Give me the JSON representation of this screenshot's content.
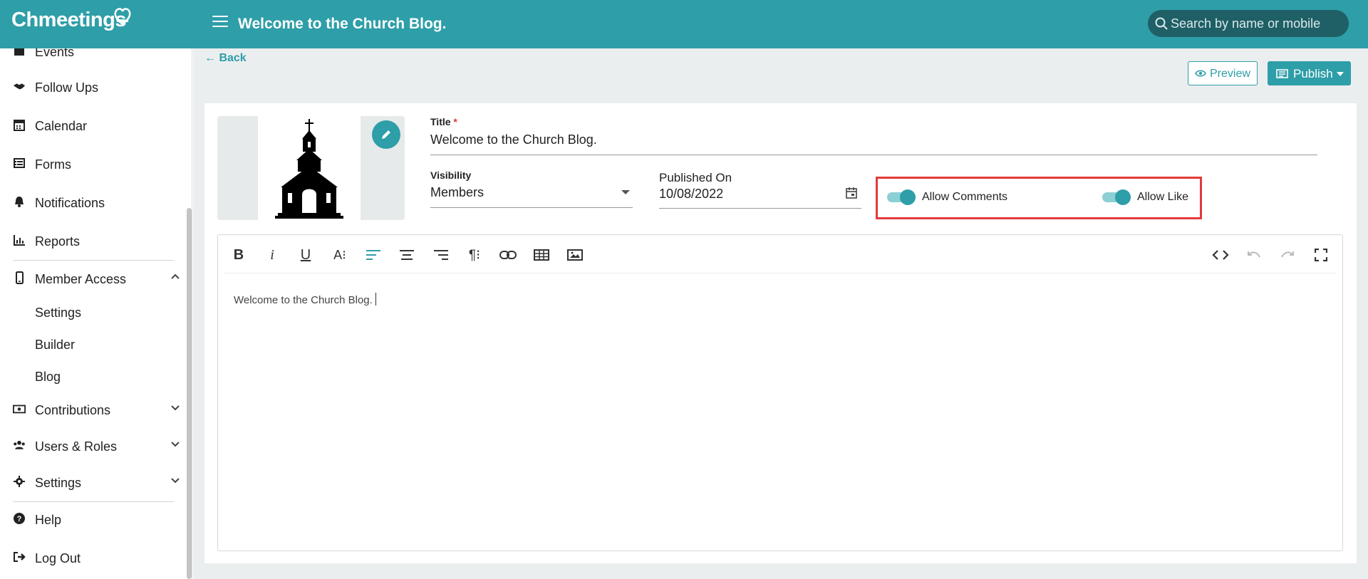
{
  "header": {
    "logo_text": "Chmeetings",
    "title": "Welcome to the Church Blog.",
    "search_placeholder": "Search by name or mobile"
  },
  "sidebar": {
    "items": [
      {
        "label": "Events",
        "icon": "calendar-event-icon"
      },
      {
        "label": "Follow Ups",
        "icon": "handshake-icon"
      },
      {
        "label": "Calendar",
        "icon": "calendar-icon"
      },
      {
        "label": "Forms",
        "icon": "form-icon"
      },
      {
        "label": "Notifications",
        "icon": "bell-icon"
      },
      {
        "label": "Reports",
        "icon": "chart-icon"
      },
      {
        "label": "Member Access",
        "icon": "mobile-icon",
        "expanded": true
      },
      {
        "label": "Contributions",
        "icon": "money-icon"
      },
      {
        "label": "Users & Roles",
        "icon": "users-icon"
      },
      {
        "label": "Settings",
        "icon": "gear-icon"
      },
      {
        "label": "Help",
        "icon": "question-icon"
      },
      {
        "label": "Log Out",
        "icon": "logout-icon"
      }
    ],
    "member_access_sub": [
      "Settings",
      "Builder",
      "Blog"
    ]
  },
  "page": {
    "back_label": "Back",
    "preview_label": "Preview",
    "publish_label": "Publish"
  },
  "form": {
    "title_label": "Title",
    "required_mark": "*",
    "title_value": "Welcome to the Church Blog.",
    "visibility_label": "Visibility",
    "visibility_value": "Members",
    "published_label": "Published On",
    "published_value": "10/08/2022",
    "allow_comments_label": "Allow Comments",
    "allow_comments_on": true,
    "allow_like_label": "Allow Like",
    "allow_like_on": true
  },
  "editor": {
    "content": "Welcome to the Church Blog."
  },
  "colors": {
    "accent": "#2e9ea8",
    "highlight": "#e23b3b"
  }
}
